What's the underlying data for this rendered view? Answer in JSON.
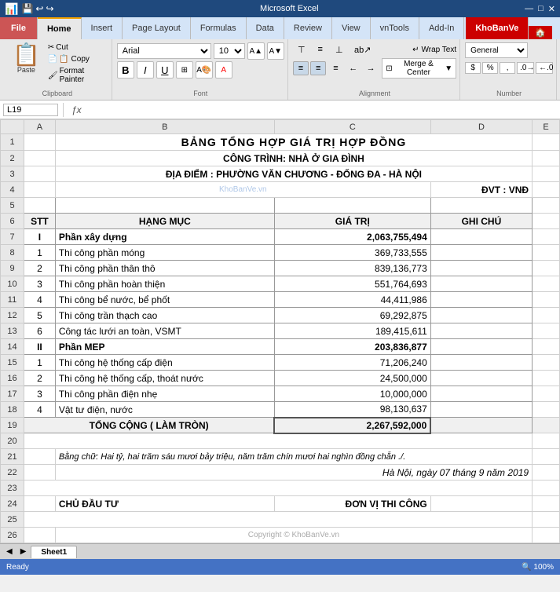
{
  "titlebar": {
    "icons": [
      "save",
      "undo",
      "redo"
    ],
    "title": "Microsoft Excel"
  },
  "ribbon": {
    "tabs": [
      "File",
      "Home",
      "Insert",
      "Page Layout",
      "Formulas",
      "Data",
      "Review",
      "View",
      "vnTools",
      "Add-In",
      "KhoBanVe"
    ],
    "active_tab": "Home",
    "clipboard": {
      "label": "Clipboard",
      "paste": "Paste",
      "cut": "✂ Cut",
      "copy": "📋 Copy",
      "format_painter": "Format Painter"
    },
    "font": {
      "label": "Font",
      "name": "Arial",
      "size": "10",
      "bold": "B",
      "italic": "I",
      "underline": "U"
    },
    "alignment": {
      "label": "Alignment",
      "wrap_text": "Wrap Text",
      "merge_center": "Merge & Center"
    },
    "number": {
      "label": "Number",
      "format": "General"
    }
  },
  "formula_bar": {
    "cell_ref": "L19",
    "formula": ""
  },
  "columns": [
    "",
    "A",
    "B",
    "C",
    "D",
    "E"
  ],
  "rows": [
    {
      "num": "1",
      "content": "title"
    },
    {
      "num": "2",
      "content": "subtitle1"
    },
    {
      "num": "3",
      "content": "subtitle2"
    },
    {
      "num": "4",
      "content": "unit"
    },
    {
      "num": "5",
      "content": "headers"
    },
    {
      "num": "6",
      "content": "col_headers"
    },
    {
      "num": "7",
      "content": "row_I"
    },
    {
      "num": "8",
      "content": "row_1"
    },
    {
      "num": "9",
      "content": "row_2"
    },
    {
      "num": "10",
      "content": "row_3"
    },
    {
      "num": "11",
      "content": "row_4"
    },
    {
      "num": "12",
      "content": "row_5"
    },
    {
      "num": "13",
      "content": "row_6"
    },
    {
      "num": "14",
      "content": "row_II"
    },
    {
      "num": "15",
      "content": "row_II_1"
    },
    {
      "num": "16",
      "content": "row_II_2"
    },
    {
      "num": "17",
      "content": "row_II_3"
    },
    {
      "num": "18",
      "content": "row_II_4"
    },
    {
      "num": "19",
      "content": "row_total"
    },
    {
      "num": "20",
      "content": "empty"
    },
    {
      "num": "21",
      "content": "words"
    },
    {
      "num": "22",
      "content": "date"
    },
    {
      "num": "23",
      "content": "empty2"
    },
    {
      "num": "24",
      "content": "signatures"
    },
    {
      "num": "25",
      "content": "empty3"
    },
    {
      "num": "26",
      "content": "copyright"
    }
  ],
  "sheet": {
    "title": "BẢNG TỔNG HỢP GIÁ TRỊ HỢP ĐỒNG",
    "subtitle1": "CÔNG TRÌNH: NHÀ Ở GIA ĐÌNH",
    "subtitle2": "ĐỊA ĐIỂM :  PHƯỜNG VĂN CHƯƠNG - ĐỐNG ĐA - HÀ NỘI",
    "watermark": "KhoBanVe.vn",
    "unit_label": "ĐVT : VNĐ",
    "col_stt": "STT",
    "col_hangmuc": "HẠNG MỤC",
    "col_giaTri": "GIÁ TRỊ",
    "col_ghiChu": "GHI CHÚ",
    "items": [
      {
        "stt": "I",
        "hangMuc": "Phần xây dựng",
        "giaTri": "2,063,755,494",
        "bold": true
      },
      {
        "stt": "1",
        "hangMuc": "Thi công phần móng",
        "giaTri": "369,733,555",
        "bold": false
      },
      {
        "stt": "2",
        "hangMuc": "Thi công phần thân thô",
        "giaTri": "839,136,773",
        "bold": false
      },
      {
        "stt": "3",
        "hangMuc": "Thi công phần hoàn thiện",
        "giaTri": "551,764,693",
        "bold": false
      },
      {
        "stt": "4",
        "hangMuc": "Thi công bể nước, bể phốt",
        "giaTri": "44,411,986",
        "bold": false
      },
      {
        "stt": "5",
        "hangMuc": "Thi công trần thạch cao",
        "giaTri": "69,292,875",
        "bold": false
      },
      {
        "stt": "6",
        "hangMuc": "Công tác lưới an toàn, VSMT",
        "giaTri": "189,415,611",
        "bold": false
      },
      {
        "stt": "II",
        "hangMuc": "Phần MEP",
        "giaTri": "203,836,877",
        "bold": true
      },
      {
        "stt": "1",
        "hangMuc": "Thi công hệ thống cấp điện",
        "giaTri": "71,206,240",
        "bold": false
      },
      {
        "stt": "2",
        "hangMuc": "Thi công hệ thống cấp, thoát nước",
        "giaTri": "24,500,000",
        "bold": false
      },
      {
        "stt": "3",
        "hangMuc": "Thi công phần điện nhẹ",
        "giaTri": "10,000,000",
        "bold": false
      },
      {
        "stt": "4",
        "hangMuc": "Vật tư điện, nước",
        "giaTri": "98,130,637",
        "bold": false
      }
    ],
    "total_label": "TỔNG CỘNG ( LÀM TRÒN)",
    "total_value": "2,267,592,000",
    "words_text": "Bằng chữ: Hai tỷ, hai trăm sáu mươi bảy triệu, năm trăm chín mươi hai nghìn đồng chẵn ./.",
    "date_text": "Hà Nội, ngày 07 tháng 9 năm 2019",
    "sig_left": "CHỦ ĐẦU TƯ",
    "sig_right": "ĐƠN VỊ THI CÔNG",
    "copyright": "Copyright © KhoBanVe.vn"
  },
  "sheet_tab": "Sheet1",
  "status": {
    "left": "Ready",
    "right": "100%"
  }
}
